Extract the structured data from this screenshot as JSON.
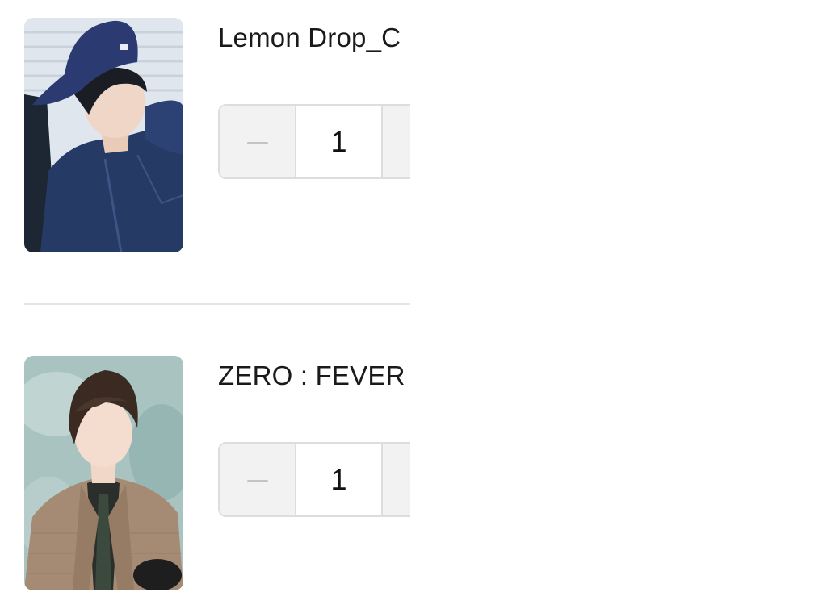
{
  "cart": {
    "items": [
      {
        "title": "Lemon Drop_C",
        "quantity": "1",
        "image": "photocard-man-denim-cap"
      },
      {
        "title": "ZERO : FEVER",
        "quantity": "1",
        "image": "photocard-man-tweed-jacket"
      }
    ]
  },
  "icons": {
    "decrement": "minus-icon",
    "increment": "plus-icon"
  },
  "colors": {
    "stepper_border": "#dddddd",
    "stepper_button_bg": "#f2f2f2",
    "icon_gray": "#c4c4c4",
    "divider": "#e4e4e4",
    "text": "#1a1a1a"
  }
}
